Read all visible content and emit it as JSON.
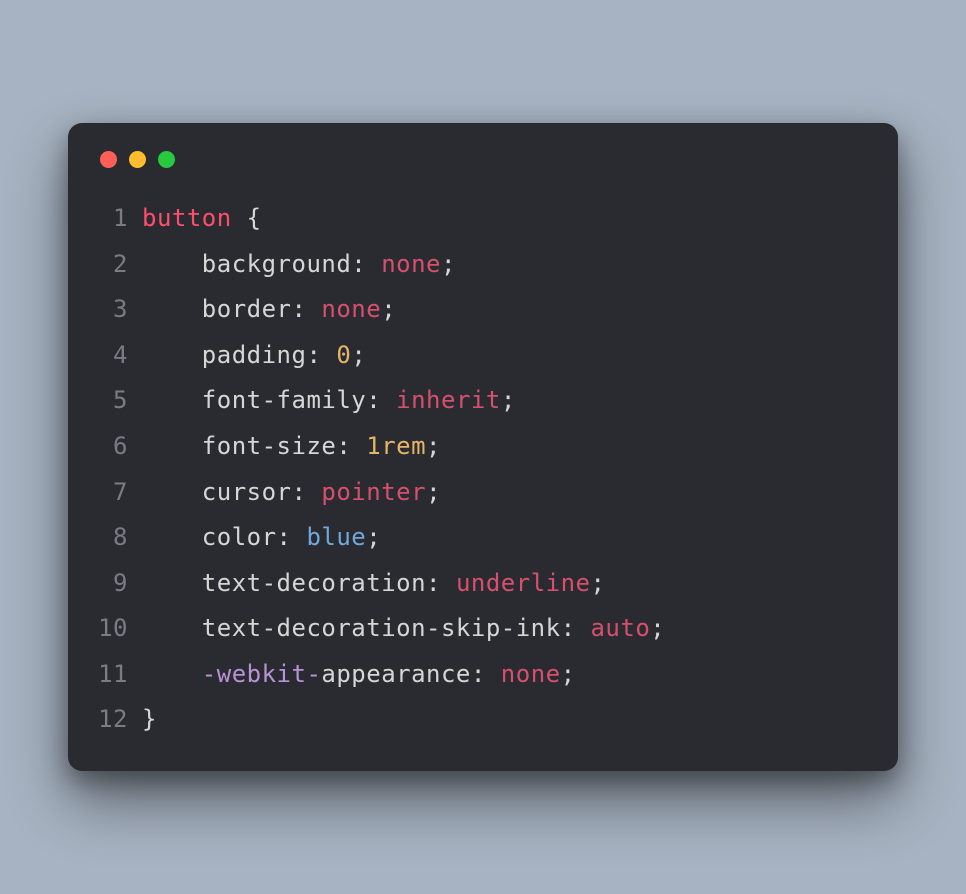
{
  "traffic": {
    "red": "#ff5f56",
    "yellow": "#ffbd2e",
    "green": "#27c93f"
  },
  "code": {
    "selector": "button",
    "brace_open": "{",
    "brace_close": "}",
    "lines": [
      {
        "n": "1"
      },
      {
        "n": "2",
        "prop": "background",
        "sep": ": ",
        "val": "none",
        "valClass": "valkw",
        "end": ";"
      },
      {
        "n": "3",
        "prop": "border",
        "sep": ": ",
        "val": "none",
        "valClass": "valkw",
        "end": ";"
      },
      {
        "n": "4",
        "prop": "padding",
        "sep": ": ",
        "val": "0",
        "valClass": "num",
        "end": ";"
      },
      {
        "n": "5",
        "prop": "font-family",
        "sep": ": ",
        "val": "inherit",
        "valClass": "valkw",
        "end": ";"
      },
      {
        "n": "6",
        "prop": "font-size",
        "sep": ": ",
        "val": "1rem",
        "valClass": "num",
        "end": ";"
      },
      {
        "n": "7",
        "prop": "cursor",
        "sep": ": ",
        "val": "pointer",
        "valClass": "valkw",
        "end": ";"
      },
      {
        "n": "8",
        "prop": "color",
        "sep": ": ",
        "val": "blue",
        "valClass": "color",
        "end": ";"
      },
      {
        "n": "9",
        "prop": "text-decoration",
        "sep": ": ",
        "val": "underline",
        "valClass": "valkw",
        "end": ";"
      },
      {
        "n": "10",
        "prop": "text-decoration-skip-ink",
        "sep": ": ",
        "val": "auto",
        "valClass": "valkw",
        "end": ";"
      },
      {
        "n": "11",
        "vendor": "-webkit-",
        "prop": "appearance",
        "sep": ": ",
        "val": "none",
        "valClass": "valkw",
        "end": ";"
      },
      {
        "n": "12"
      }
    ],
    "indent": "    "
  }
}
